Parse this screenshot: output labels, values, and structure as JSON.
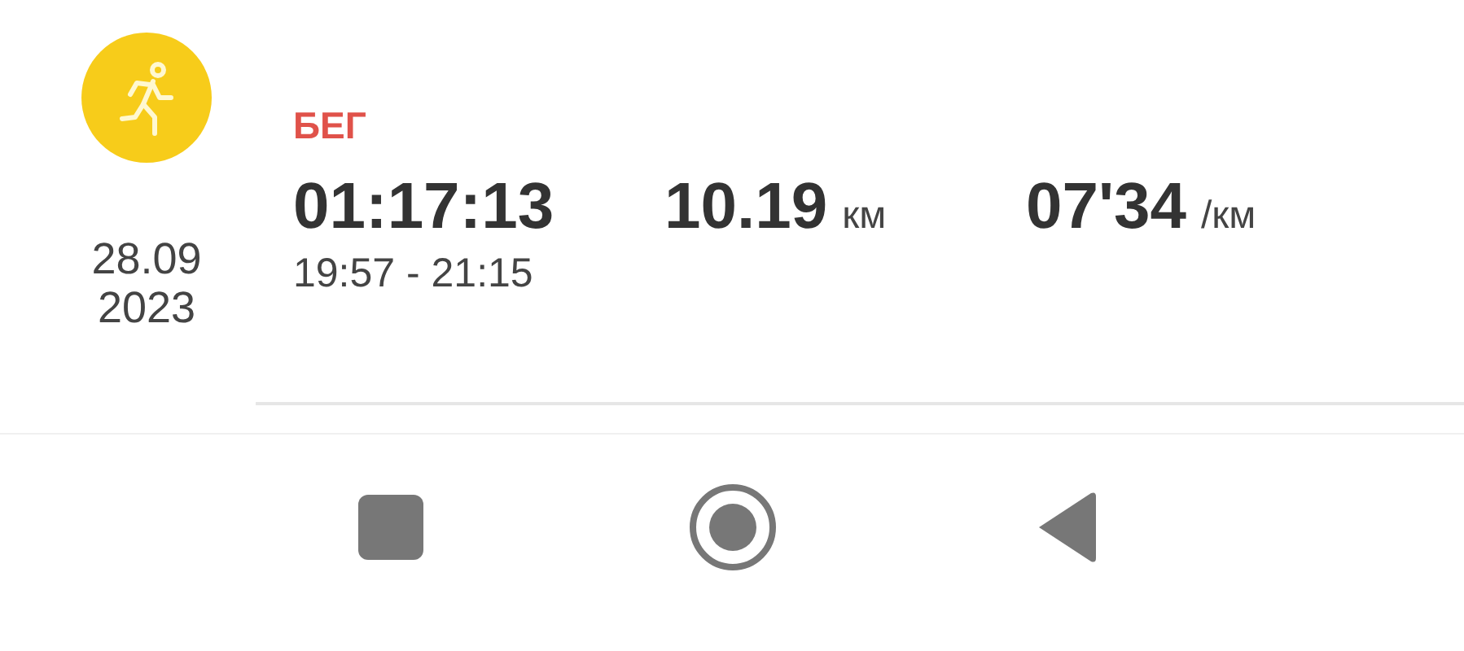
{
  "workout": {
    "date": "28.09",
    "year": "2023",
    "activity": "БЕГ",
    "stats": [
      {
        "value": "01:17:13"
      },
      {
        "value": "10.19",
        "unit": "км"
      },
      {
        "value": "07'34",
        "unit": "/км"
      }
    ],
    "time_range": "19:57 - 21:15"
  }
}
